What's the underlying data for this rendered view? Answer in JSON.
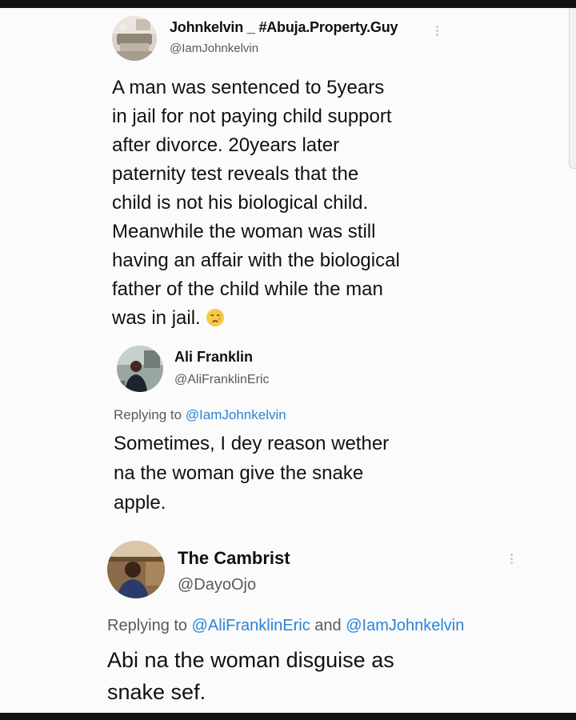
{
  "tweets": [
    {
      "author_name": "Johnkelvin _ #Abuja.Property.Guy",
      "author_handle": "@IamJohnkelvin",
      "text": "A man was sentenced to 5years\nin jail for not paying child support\nafter divorce. 20years later\npaternity test reveals that the\nchild is not his biological child.\nMeanwhile the woman was still\nhaving an affair with the biological\nfather of the child while the man\nwas in jail.",
      "emoji": "crying-face-emoji"
    },
    {
      "author_name": "Ali Franklin",
      "author_handle": "@AliFranklinEric",
      "replying_prefix": "Replying to ",
      "replying_to": "@IamJohnkelvin",
      "text": "Sometimes, I dey reason wether\nna  the woman give the snake\napple."
    },
    {
      "author_name": "The Cambrist",
      "author_handle": "@DayoOjo",
      "replying_prefix": "Replying to ",
      "replying_to_1": "@AliFranklinEric",
      "replying_and": " and ",
      "replying_to_2": "@IamJohnkelvin",
      "text": "Abi na the woman disguise as\nsnake sef."
    }
  ],
  "colors": {
    "mention": "#2b84d6",
    "secondary_text": "#555b61"
  }
}
